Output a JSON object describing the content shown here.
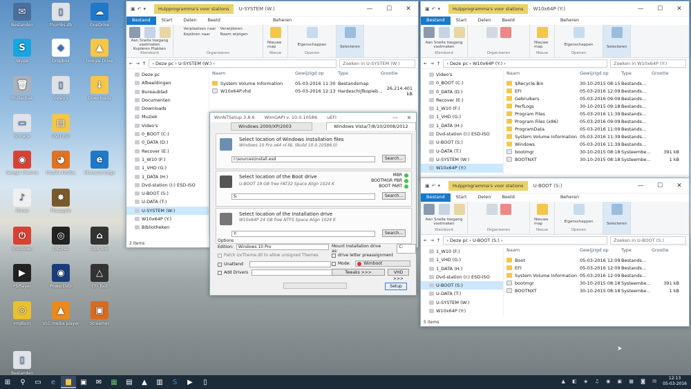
{
  "desktop_icons": [
    {
      "label": "Bestanden",
      "color": "#4a6f9c",
      "glyph": "✉"
    },
    {
      "label": "thumbs.db",
      "color": "#dfe2e6",
      "glyph": "▯"
    },
    {
      "label": "OneDrive",
      "color": "#1f78c8",
      "glyph": "☁"
    },
    {
      "label": "Skype",
      "color": "#16a6e0",
      "glyph": "S"
    },
    {
      "label": "Dropbox",
      "color": "#fff",
      "glyph": "◆"
    },
    {
      "label": "Google Drive",
      "color": "#f4c64a",
      "glyph": "▲"
    },
    {
      "label": "Prullenbak",
      "color": "#aab3bd",
      "glyph": "🗑"
    },
    {
      "label": "Video's",
      "color": "#dfe2e6",
      "glyph": "▯"
    },
    {
      "label": "Downloads",
      "color": "#f4c64a",
      "glyph": "↓"
    },
    {
      "label": "Storage",
      "color": "#e0e3e7",
      "glyph": "▭"
    },
    {
      "label": "DVD ISO",
      "color": "#f4c64a",
      "glyph": "▤"
    },
    {
      "label": "Google Chrome",
      "color": "#d94233",
      "glyph": "◉"
    },
    {
      "label": "Mozilla Firefox",
      "color": "#e2721f",
      "glyph": "◕"
    },
    {
      "label": "Microsoft Edge",
      "color": "#1f78c8",
      "glyph": "e"
    },
    {
      "label": "iTunes",
      "color": "#f0f0f0",
      "glyph": "♪"
    },
    {
      "label": "Pineapple",
      "color": "#7a5a2c",
      "glyph": "✸"
    },
    {
      "label": "Shutdown",
      "color": "#d94233",
      "glyph": "⏻"
    },
    {
      "label": "DVDFab",
      "color": "#222",
      "glyph": "◎"
    },
    {
      "label": "USB Tool",
      "color": "#333",
      "glyph": "⌂"
    },
    {
      "label": "PSPlayer",
      "color": "#222",
      "glyph": "▶"
    },
    {
      "label": "PowerDVD",
      "color": "#1a3c7a",
      "glyph": "◉"
    },
    {
      "label": "EFI Tool",
      "color": "#333",
      "glyph": "△"
    },
    {
      "label": "ImgBurn",
      "color": "#e8c12c",
      "glyph": "◎"
    },
    {
      "label": "VLC media player",
      "color": "#e98a1f",
      "glyph": "▲"
    },
    {
      "label": "Streamer",
      "color": "#d96a1f",
      "glyph": "▣"
    },
    {
      "label": "Bestanden",
      "color": "#dfe2e6",
      "glyph": "▯"
    }
  ],
  "left_explorer": {
    "tabs": {
      "file": "Bestand",
      "start": "Start",
      "share": "Delen",
      "view": "Beeld",
      "manage": "Beheren"
    },
    "hp": "Hulpprogramma's voor stations",
    "title": "U-SYSTEM (W:)",
    "ribbon": {
      "pin": "Aan Snelle toegang vastmaken",
      "copy": "Kopiëren",
      "paste": "Plakken",
      "group_clip": "Klembord",
      "move": "Verplaatsen naar",
      "copyto": "Kopiëren naar",
      "delete": "Verwijderen",
      "rename": "Naam wijzigen",
      "group_org": "Organiseren",
      "newfolder": "Nieuwe map",
      "group_new": "Nieuw",
      "props": "Eigenschappen",
      "group_open": "Openen",
      "select": "Selecteren"
    },
    "path": "›  Deze pc  ›  U-SYSTEM (W:)  ›",
    "search": "Zoeken in U-SYSTEM (W:)",
    "nav": [
      "Deze pc",
      "Afbeeldingen",
      "Bureaublad",
      "Documenten",
      "Downloads",
      "Muziek",
      "Video's",
      "0_BOOT (C:)",
      "0_DATA (D:)",
      "Recover (E:)",
      "1_W10 (F:)",
      "1_VHD (G:)",
      "1_DATA (H:)",
      "Dvd-station (I:) ESD-ISO",
      "U-BOOT (S:)",
      "U-DATA (T:)",
      "U-SYSTEM (W:)",
      "W10x64P (Y:)",
      "Bibliotheken"
    ],
    "cols": [
      "Naam",
      "Gewijzigd op",
      "Type",
      "Grootte"
    ],
    "files": [
      [
        "System Volume Information",
        "05-03-2016 11:30",
        "Bestandsmap",
        ""
      ],
      [
        "W10x64P.vhd",
        "05-03-2016 12:13",
        "Hardeschijfkopieb...",
        "26.214.401 kB"
      ]
    ],
    "status": "2 items"
  },
  "right_explorer_top": {
    "tabs": {
      "file": "Bestand",
      "start": "Start",
      "share": "Delen",
      "view": "Beeld",
      "manage": "Beheren"
    },
    "hp": "Hulpprogramma's voor stations",
    "title": "W10x64P (Y:)",
    "ribbon": {
      "pin": "Aan Snelle toegang vastmaken",
      "copy": "Kopiëren",
      "paste": "Plakken",
      "group_clip": "Klembord",
      "group_org": "Organiseren",
      "newfolder": "Nieuwe map",
      "group_new": "Nieuw",
      "props": "Eigenschappen",
      "group_open": "Openen",
      "select": "Selecteren"
    },
    "path": "›  Deze pc  ›  W10x64P (Y:)  ›",
    "search": "Zoeken in W10x64P (Y:)",
    "nav": [
      "Video's",
      "0_BOOT (C:)",
      "0_DATA (D:)",
      "Recover (E:)",
      "1_W10 (F:)",
      "1_VHD (G:)",
      "1_DATA (H:)",
      "Dvd-station (I:) ESD-ISO",
      "U-BOOT (S:)",
      "U-DATA (T:)",
      "U-SYSTEM (W:)",
      "W10x64P (Y:)"
    ],
    "cols": [
      "Naam",
      "Gewijzigd op",
      "Type",
      "Grootte"
    ],
    "files": [
      [
        "$Recycle.Bin",
        "30-10-2015 08:15",
        "Bestands...",
        ""
      ],
      [
        "EFI",
        "05-03-2016 12:09",
        "Bestands...",
        ""
      ],
      [
        "Gebruikers",
        "05-03-2016 09:09",
        "Bestands...",
        ""
      ],
      [
        "PerfLogs",
        "30-10-2015 09:18",
        "Bestands...",
        ""
      ],
      [
        "Program Files",
        "05-03-2016 11:39",
        "Bestands...",
        ""
      ],
      [
        "Program Files (x86)",
        "05-03-2016 09:09",
        "Bestands...",
        ""
      ],
      [
        "ProgramData",
        "05-03-2016 11:09",
        "Bestands...",
        ""
      ],
      [
        "System Volume Information",
        "05-03-2016 11:39",
        "Bestands...",
        ""
      ],
      [
        "Windows",
        "05-03-2016 11:39",
        "Bestands...",
        ""
      ],
      [
        "bootmgr",
        "30-10-2015 08:18",
        "Systeembe...",
        "391 kB"
      ],
      [
        "BOOTNXT",
        "30-10-2015 08:18",
        "Systeembe...",
        "1 kB"
      ]
    ]
  },
  "right_explorer_bottom": {
    "tabs": {
      "file": "Bestand",
      "start": "Start",
      "share": "Delen",
      "view": "Beeld",
      "manage": "Beheren"
    },
    "hp": "Hulpprogramma's voor stations",
    "title": "U-BOOT (S:)",
    "ribbon": {
      "pin": "Aan Snelle toegang vastmaken",
      "copy": "Kopiëren",
      "paste": "Plakken",
      "group_clip": "Klembord",
      "group_org": "Organiseren",
      "newfolder": "Nieuwe map",
      "group_new": "Nieuw",
      "props": "Eigenschappen",
      "group_open": "Openen",
      "select": "Selecteren"
    },
    "path": "›  Deze pc  ›  U-BOOT (S:)  ›",
    "search": "Zoeken in U-BOOT (S:)",
    "nav": [
      "1_W10 (F:)",
      "1_VHD (G:)",
      "1_DATA (H:)",
      "Dvd-station (I:) ESD-ISO",
      "U-BOOT (S:)",
      "U-DATA (T:)",
      "U-SYSTEM (W:)",
      "W10x64P (Y:)"
    ],
    "cols": [
      "Naam",
      "Gewijzigd op",
      "Type",
      "Grootte"
    ],
    "files": [
      [
        "Boot",
        "05-03-2016 12:09",
        "Bestands...",
        ""
      ],
      [
        "EFI",
        "05-03-2016 12:09",
        "Bestands...",
        ""
      ],
      [
        "System Volume Information",
        "05-03-2016 12:09",
        "Bestands...",
        ""
      ],
      [
        "bootmgr",
        "30-10-2015 08:18",
        "Systeembe...",
        "391 kB"
      ],
      [
        "BOOTNXT",
        "30-10-2015 08:18",
        "Systeembe...",
        "1 kB"
      ]
    ],
    "status": "5 items"
  },
  "winntsetup": {
    "title": "WinNTSetup 3.8.6",
    "wimgapi": "WimGAPI v. 10.0.10586",
    "efi": "uEFI",
    "tab1": "Windows 2000/XP/2003",
    "tab2": "Windows Vista/7/8/10/2008/2012",
    "s1_h": "Select location of Windows installation files",
    "s1_s": "Windows 10 Pro x64 nl-NL (Build 10.0.10586.0)",
    "s1_v": "I:\\sources\\install.esd",
    "search": "Search...",
    "s2_h": "Select location of the Boot drive",
    "s2_s": "U-BOOT 19 GB free FAT32 Space Align 1024 K",
    "s2_v": "S:",
    "mbr": "MBR",
    "bootmgr": "BOOTMGR PBR",
    "bootpart": "BOOT PART",
    "s3_h": "Select location of the Installation drive",
    "s3_s": "W10x64P 24 GB free NTFS Space Align 1024 K",
    "s3_v": "Y:",
    "options": "Options",
    "edition_l": "Edition:",
    "edition": "Windows 10 Pro",
    "mount_l": "Mount Installation drive as:",
    "mount": "C:",
    "patch": "Patch UxTheme.dll to allow unsigned Themes",
    "preassign": "drive letter preassignment",
    "unattend": "Unattend",
    "mode": "Mode:",
    "wimboot": "Wimboot",
    "adddrivers": "Add Drivers",
    "tweaks": "Tweaks >>>",
    "vhd": "VHD >>>",
    "setup": "Setup"
  },
  "taskbar": {
    "time": "12:13",
    "date": "05-03-2016"
  }
}
